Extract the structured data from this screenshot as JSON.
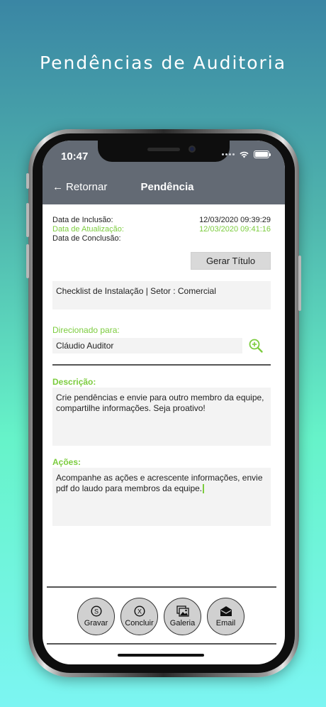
{
  "headline": "Pendências de Auditoria",
  "status_bar": {
    "time": "10:47"
  },
  "nav": {
    "back_label": "Retornar",
    "title": "Pendência"
  },
  "dates": {
    "inclusao_label": "Data de Inclusão:",
    "inclusao_value": "12/03/2020 09:39:29",
    "atualizacao_label": "Data de Atualização:",
    "atualizacao_value": "12/03/2020 09:41:16",
    "conclusao_label": "Data de Conclusão:",
    "conclusao_value": ""
  },
  "gerar_button": "Gerar Título",
  "checklist": "Checklist de Instalação | Setor : Comercial",
  "direcionado": {
    "label": "Direcionado para:",
    "value": "Cláudio Auditor"
  },
  "descricao": {
    "label": "Descrição:",
    "text": "Crie pendências e envie para outro membro da equipe, compartilhe informações. Seja proativo!"
  },
  "acoes": {
    "label": "Ações:",
    "text": "Acompanhe as ações e acrescente informações, envie pdf do laudo para membros da equipe."
  },
  "actions": [
    {
      "label": "Gravar",
      "icon": "s-circle-icon"
    },
    {
      "label": "Concluir",
      "icon": "x-circle-icon"
    },
    {
      "label": "Galeria",
      "icon": "gallery-icon"
    },
    {
      "label": "Email",
      "icon": "envelope-icon"
    }
  ],
  "colors": {
    "green": "#7ccc3e",
    "navbar": "#636a74"
  }
}
